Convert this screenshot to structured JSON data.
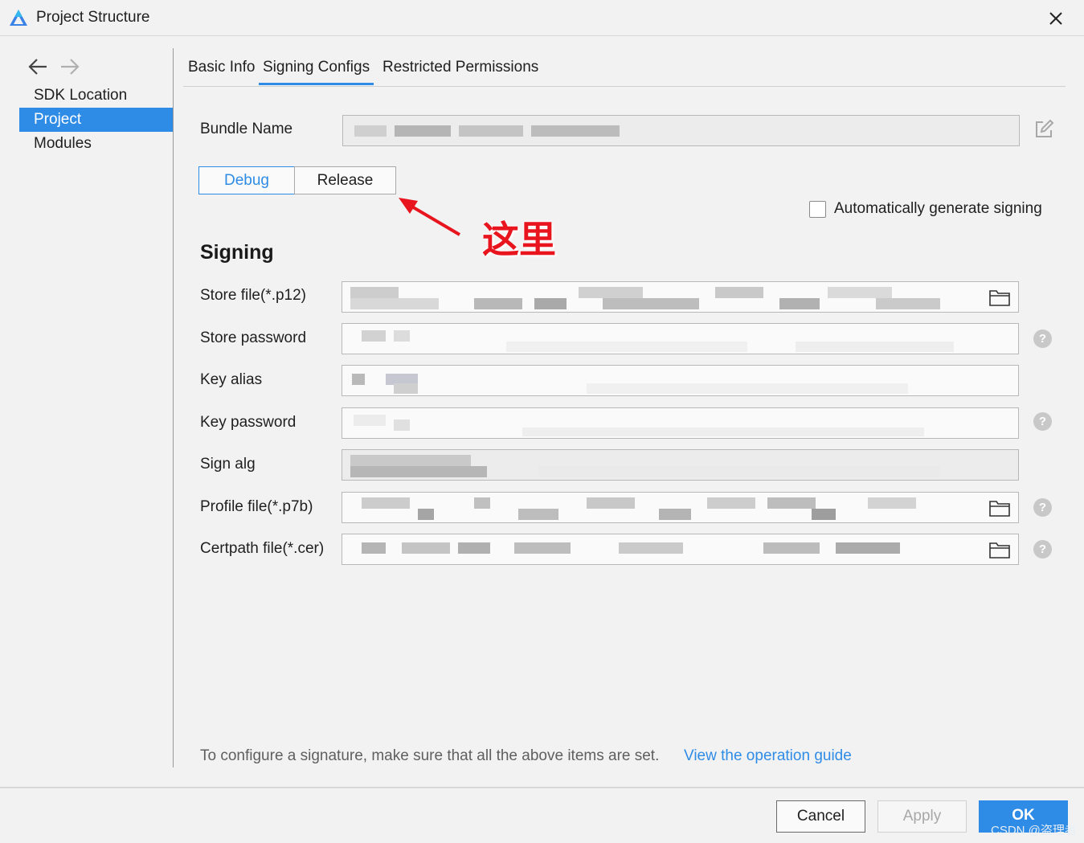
{
  "window": {
    "title": "Project Structure"
  },
  "sidebar": {
    "items": [
      {
        "label": "SDK Location"
      },
      {
        "label": "Project"
      },
      {
        "label": "Modules"
      }
    ]
  },
  "tabs": [
    {
      "label": "Basic Info"
    },
    {
      "label": "Signing Configs"
    },
    {
      "label": "Restricted Permissions"
    }
  ],
  "bundle": {
    "label": "Bundle Name"
  },
  "build_types": {
    "debug": "Debug",
    "release": "Release"
  },
  "auto_sign": {
    "label": "Automatically generate signing",
    "checked": false
  },
  "annotation": {
    "text": "这里"
  },
  "signing": {
    "title": "Signing",
    "fields": [
      {
        "label": "Store file(*.p12)"
      },
      {
        "label": "Store password"
      },
      {
        "label": "Key alias"
      },
      {
        "label": "Key password"
      },
      {
        "label": "Sign alg"
      },
      {
        "label": "Profile file(*.p7b)"
      },
      {
        "label": "Certpath file(*.cer)"
      }
    ]
  },
  "footer": {
    "note": "To configure a signature, make sure that all the above items are set.",
    "link": "View the operation guide"
  },
  "buttons": {
    "cancel": "Cancel",
    "apply": "Apply",
    "ok": "OK"
  },
  "watermark": "CSDN @盗理者",
  "colors": {
    "accent": "#2f8ce6",
    "annotation": "#e8141e"
  }
}
